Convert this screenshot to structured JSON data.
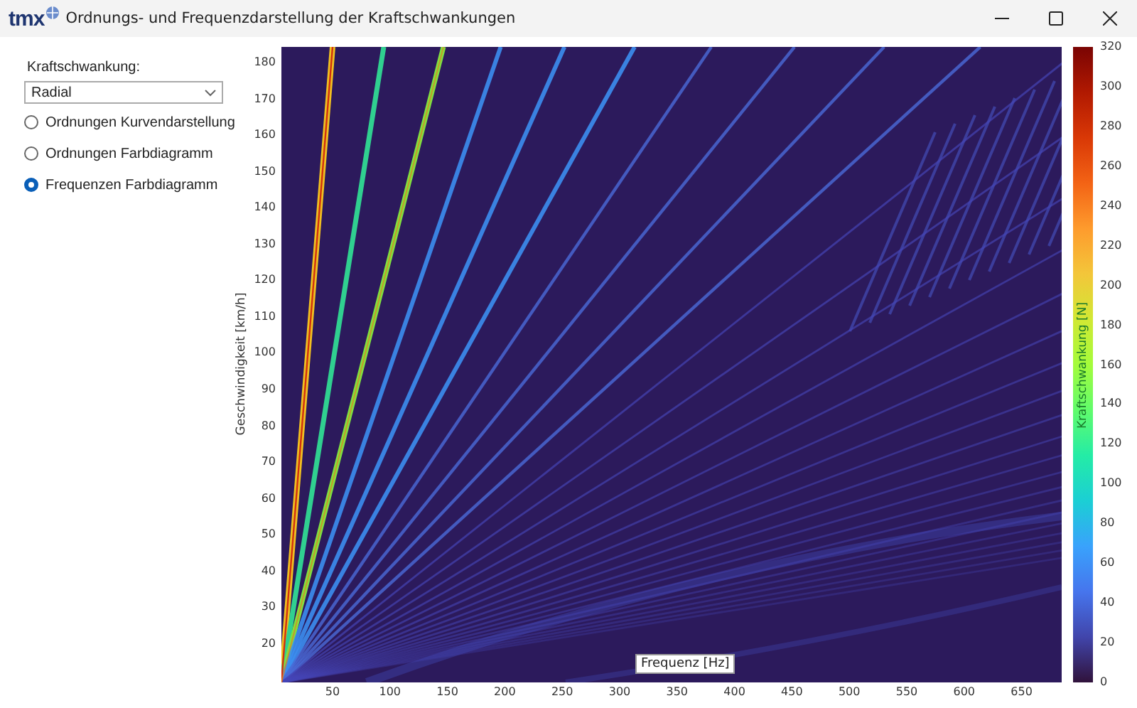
{
  "window": {
    "logo": "tmx",
    "title": "Ordnungs- und Frequenzdarstellung der Kraftschwankungen"
  },
  "sidebar": {
    "label": "Kraftschwankung:",
    "dropdown": {
      "value": "Radial"
    },
    "options": [
      {
        "label": "Ordnungen Kurvendarstellung",
        "selected": false
      },
      {
        "label": "Ordnungen Farbdiagramm",
        "selected": false
      },
      {
        "label": "Frequenzen Farbdiagramm",
        "selected": true
      }
    ]
  },
  "plot": {
    "xlabel": "Frequenz [Hz]",
    "ylabel": "Geschwindigkeit [km/h]",
    "xticks": [
      "50",
      "100",
      "150",
      "200",
      "250",
      "300",
      "350",
      "400",
      "450",
      "500",
      "550",
      "600",
      "650"
    ],
    "yticks": [
      "180",
      "170",
      "160",
      "150",
      "140",
      "130",
      "120",
      "110",
      "100",
      "90",
      "80",
      "70",
      "60",
      "50",
      "40",
      "30",
      "20"
    ],
    "colorbar": {
      "label": "Kraftschwankung [N]",
      "ticks": [
        "320",
        "300",
        "280",
        "260",
        "240",
        "220",
        "200",
        "180",
        "160",
        "140",
        "120",
        "100",
        "80",
        "60",
        "40",
        "20",
        "0"
      ]
    }
  }
}
